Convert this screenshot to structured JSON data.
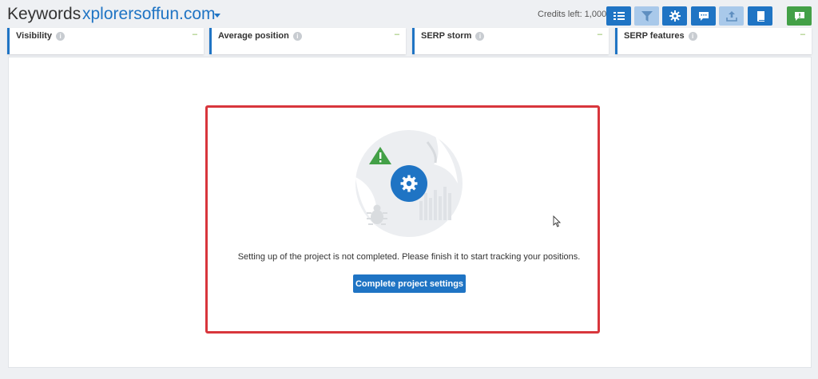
{
  "header": {
    "title": "Keywords",
    "domain": "xplorersoffun.com",
    "credits": "Credits left: 1,000"
  },
  "toolbar": {
    "buttons": [
      {
        "name": "list-view",
        "icon": "list-icon"
      },
      {
        "name": "filter",
        "icon": "filter-icon"
      },
      {
        "name": "settings",
        "icon": "gear-icon"
      },
      {
        "name": "comments",
        "icon": "comment-icon"
      },
      {
        "name": "export",
        "icon": "upload-icon"
      },
      {
        "name": "book",
        "icon": "book-icon"
      },
      {
        "name": "feedback",
        "icon": "feedback-icon"
      }
    ]
  },
  "metrics": [
    {
      "label": "Visibility",
      "value": "–"
    },
    {
      "label": "Average position",
      "value": "–"
    },
    {
      "label": "SERP storm",
      "value": "–"
    },
    {
      "label": "SERP features",
      "value": "–"
    }
  ],
  "setup": {
    "message": "Setting up of the project is not completed. Please finish it to start tracking your positions.",
    "button_label": "Complete project settings"
  },
  "colors": {
    "accent": "#1f74c4",
    "highlight": "#d8363c",
    "warning": "#43a047",
    "metric_dash": "#7cb342"
  }
}
